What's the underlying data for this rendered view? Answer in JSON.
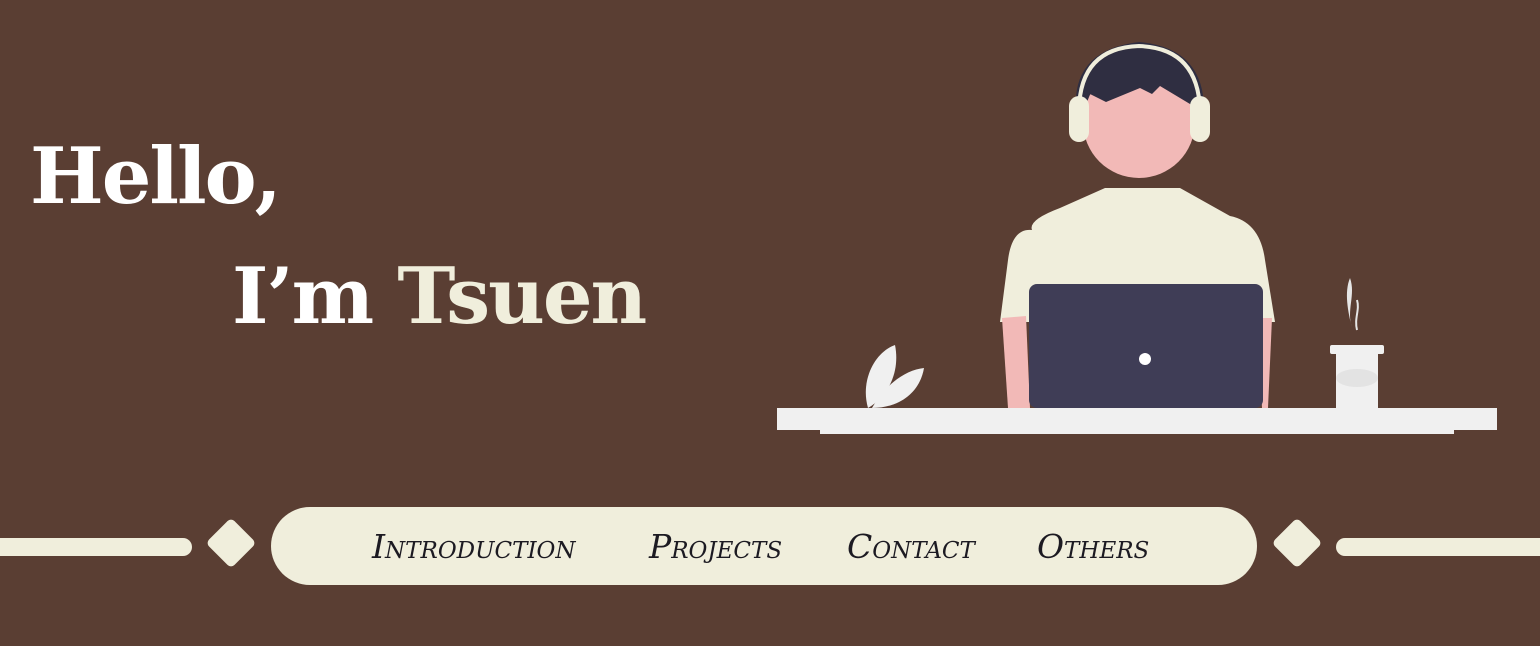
{
  "hero": {
    "greeting": "Hello,",
    "intro_prefix": "I’m ",
    "name": "Tsuen"
  },
  "nav": {
    "items": [
      {
        "label": "Introduction"
      },
      {
        "label": "Projects"
      },
      {
        "label": "Contact"
      },
      {
        "label": "Others"
      }
    ]
  },
  "colors": {
    "background": "#5a3e33",
    "cream": "#f0eedc",
    "white": "#ffffff",
    "laptop": "#3f3d56",
    "skin": "#f2b9b7",
    "hair": "#2f2e41",
    "desk": "#f0f0f0",
    "nav_text": "#1c1a22"
  },
  "icons": {
    "headphones": "headphones-icon",
    "laptop": "laptop-icon",
    "coffee": "coffee-cup-icon",
    "plant": "plant-leaf-icon"
  }
}
